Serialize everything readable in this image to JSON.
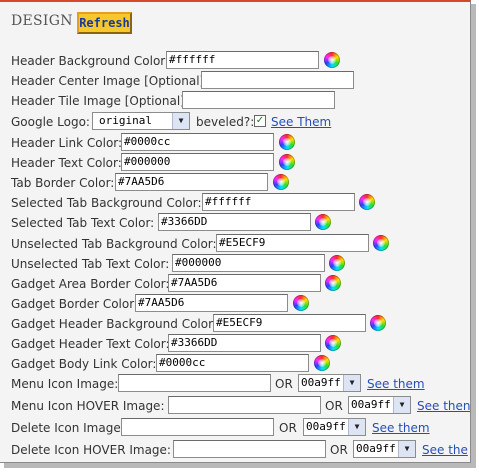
{
  "title": "DESIGN",
  "refresh_label": "Refresh",
  "rows": {
    "header_bg": {
      "label": "Header Background Color:",
      "value": "#ffffff"
    },
    "header_center": {
      "label": "Header Center Image [Optional]:",
      "value": ""
    },
    "header_tile": {
      "label": "Header Tile Image [Optional]:",
      "value": ""
    },
    "google_logo": {
      "label": "Google Logo:",
      "select": "original",
      "beveled_label": "beveled?:",
      "beveled_checked": true,
      "link": "See Them"
    },
    "header_link": {
      "label": "Header Link Color:",
      "value": "#0000cc"
    },
    "header_text": {
      "label": "Header Text Color:",
      "value": "#000000"
    },
    "tab_border": {
      "label": "Tab Border Color:",
      "value": "#7AA5D6"
    },
    "sel_tab_bg": {
      "label": "Selected Tab Background Color:",
      "value": "#ffffff"
    },
    "sel_tab_text": {
      "label": "Selected Tab Text Color:",
      "value": "#3366DD"
    },
    "unsel_tab_bg": {
      "label": "Unselected Tab Background Color:",
      "value": "#E5ECF9"
    },
    "unsel_tab_text": {
      "label": "Unselected Tab Text Color:",
      "value": "#000000"
    },
    "gadget_area_border": {
      "label": "Gadget Area Border Color:",
      "value": "#7AA5D6"
    },
    "gadget_border": {
      "label": "Gadget Border Color:",
      "value": "#7AA5D6"
    },
    "gadget_header_bg": {
      "label": "Gadget Header Background Color:",
      "value": "#E5ECF9"
    },
    "gadget_header_text": {
      "label": "Gadget Header Text Color:",
      "value": "#3366DD"
    },
    "gadget_body_link": {
      "label": "Gadget Body Link Color:",
      "value": "#0000cc"
    },
    "menu_icon": {
      "label": "Menu Icon Image:",
      "value": "",
      "or": "OR",
      "select": "00a9ff",
      "link": "See them"
    },
    "menu_icon_hover": {
      "label": "Menu Icon HOVER Image:",
      "value": "",
      "or": "OR",
      "select": "00a9ff",
      "link": "See then"
    },
    "delete_icon": {
      "label": "Delete Icon Image:",
      "value": "",
      "or": "OR",
      "select": "00a9ff",
      "link": "See them"
    },
    "delete_icon_hover": {
      "label": "Delete Icon HOVER Image:",
      "value": "",
      "or": "OR",
      "select": "00a9ff",
      "link": "See the"
    }
  },
  "colors": {
    "accent_border": "#d24a2a",
    "button": "#f7c82a",
    "link": "#2350b5"
  }
}
